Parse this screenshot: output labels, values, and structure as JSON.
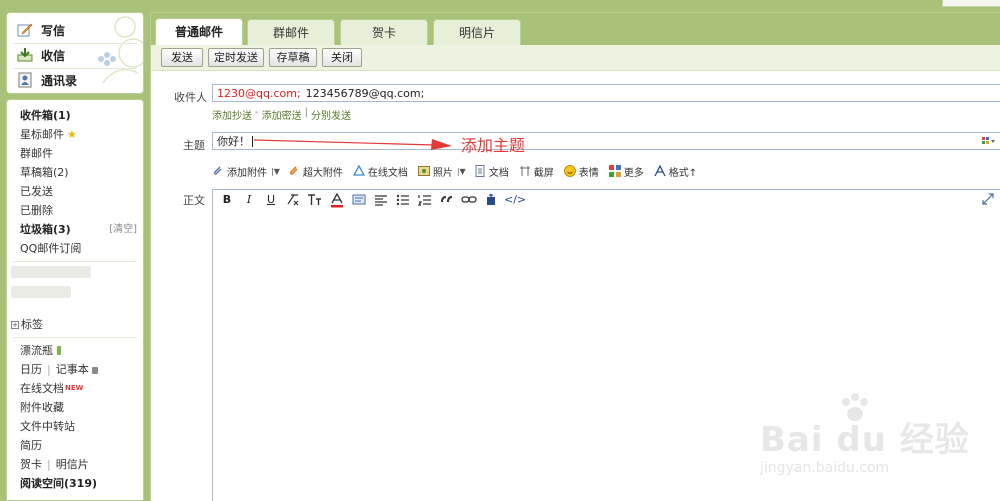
{
  "sidebar": {
    "quick": [
      {
        "label": "写信",
        "icon": "write-icon"
      },
      {
        "label": "收信",
        "icon": "receive-icon"
      },
      {
        "label": "通讯录",
        "icon": "contacts-icon"
      }
    ],
    "folders_top": [
      {
        "label": "收件箱(1)",
        "bold": true
      },
      {
        "label": "星标邮件",
        "star": true
      },
      {
        "label": "群邮件"
      },
      {
        "label": "草稿箱(2)"
      },
      {
        "label": "已发送"
      },
      {
        "label": "已删除"
      },
      {
        "label": "垃圾箱(3)",
        "bold": true,
        "extra": "[清空]"
      },
      {
        "label": "QQ邮件订阅"
      }
    ],
    "tags_label": "标签",
    "folders_bottom": {
      "drift_bottle": "漂流瓶",
      "calendar": "日历",
      "notebook": "记事本",
      "online_docs": "在线文档",
      "new_badge": "NEW",
      "attachments": "附件收藏",
      "file_transfer": "文件中转站",
      "resume": "简历",
      "cards": "贺卡",
      "postcard": "明信片",
      "reading": "阅读空间(319)"
    }
  },
  "tabs": [
    "普通邮件",
    "群邮件",
    "贺卡",
    "明信片"
  ],
  "toolbar": {
    "send": "发送",
    "scheduled": "定时发送",
    "save_draft": "存草稿",
    "close": "关闭"
  },
  "form": {
    "to_label": "收件人",
    "recipients": {
      "first": "1230@qq.com",
      "sep": ";",
      "second": "123456789@qq.com;"
    },
    "links": {
      "cc": "添加抄送",
      "bcc": "添加密送",
      "separate": "分别发送",
      "dash": "-",
      "pipe": "|"
    },
    "subject_label": "主题",
    "subject_value": "你好！",
    "annotation": "添加主题",
    "attach": {
      "attachment": "添加附件",
      "large": "超大附件",
      "online_doc": "在线文档",
      "photo": "照片",
      "doc": "文档",
      "screenshot": "截屏",
      "emoji": "表情",
      "more": "更多",
      "format": "格式↑"
    },
    "body_label": "正文"
  },
  "editor_toolbar": {
    "bold": "B",
    "italic": "I",
    "underline": "U",
    "code": "</>"
  },
  "watermark": {
    "big": "Bai du 经验",
    "small": "jingyan.baidu.com"
  },
  "colors": {
    "frame_green": "#a9c27a",
    "tab_light": "#e8efd8",
    "toolbar_bg": "#eef3e1",
    "recipient_red": "#e02020",
    "annotation_red": "#e53935",
    "link_green": "#5a7a2a"
  }
}
